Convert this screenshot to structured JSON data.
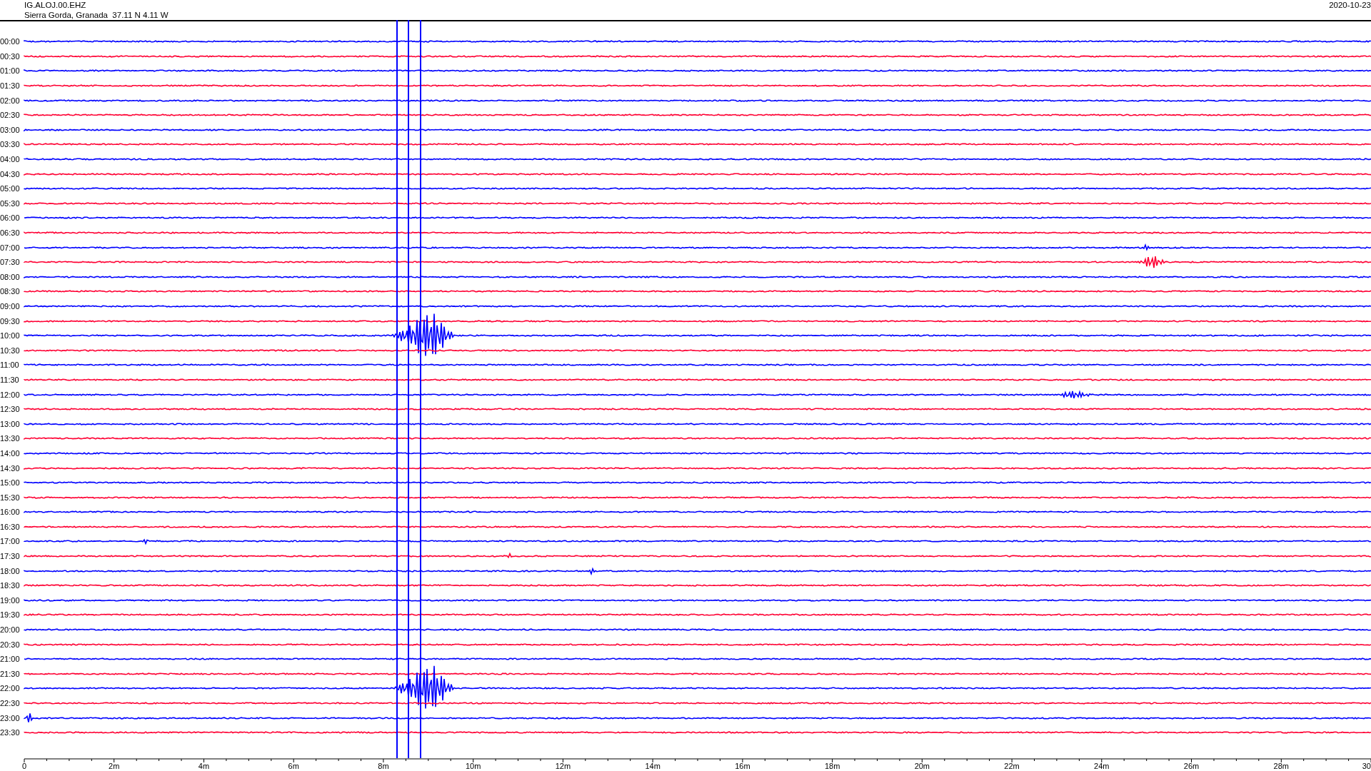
{
  "header": {
    "station": "IG.ALOJ.00.EHZ",
    "location": "Sierra Gorda, Granada  37.11 N 4.11 W",
    "date": "2020-10-23"
  },
  "rows": [
    {
      "label": "00:00",
      "color": "#0000ff"
    },
    {
      "label": "00:30",
      "color": "#ff0033"
    },
    {
      "label": "01:00",
      "color": "#0000ff"
    },
    {
      "label": "01:30",
      "color": "#ff0033"
    },
    {
      "label": "02:00",
      "color": "#0000ff"
    },
    {
      "label": "02:30",
      "color": "#ff0033"
    },
    {
      "label": "03:00",
      "color": "#0000ff"
    },
    {
      "label": "03:30",
      "color": "#ff0033"
    },
    {
      "label": "04:00",
      "color": "#0000ff"
    },
    {
      "label": "04:30",
      "color": "#ff0033"
    },
    {
      "label": "05:00",
      "color": "#0000ff"
    },
    {
      "label": "05:30",
      "color": "#ff0033"
    },
    {
      "label": "06:00",
      "color": "#0000ff"
    },
    {
      "label": "06:30",
      "color": "#ff0033"
    },
    {
      "label": "07:00",
      "color": "#0000ff"
    },
    {
      "label": "07:30",
      "color": "#ff0033"
    },
    {
      "label": "08:00",
      "color": "#0000ff"
    },
    {
      "label": "08:30",
      "color": "#ff0033"
    },
    {
      "label": "09:00",
      "color": "#0000ff"
    },
    {
      "label": "09:30",
      "color": "#ff0033"
    },
    {
      "label": "10:00",
      "color": "#0000ff"
    },
    {
      "label": "10:30",
      "color": "#ff0033"
    },
    {
      "label": "11:00",
      "color": "#0000ff"
    },
    {
      "label": "11:30",
      "color": "#ff0033"
    },
    {
      "label": "12:00",
      "color": "#0000ff"
    },
    {
      "label": "12:30",
      "color": "#ff0033"
    },
    {
      "label": "13:00",
      "color": "#0000ff"
    },
    {
      "label": "13:30",
      "color": "#ff0033"
    },
    {
      "label": "14:00",
      "color": "#0000ff"
    },
    {
      "label": "14:30",
      "color": "#ff0033"
    },
    {
      "label": "15:00",
      "color": "#0000ff"
    },
    {
      "label": "15:30",
      "color": "#ff0033"
    },
    {
      "label": "16:00",
      "color": "#0000ff"
    },
    {
      "label": "16:30",
      "color": "#ff0033"
    },
    {
      "label": "17:00",
      "color": "#0000ff"
    },
    {
      "label": "17:30",
      "color": "#ff0033"
    },
    {
      "label": "18:00",
      "color": "#0000ff"
    },
    {
      "label": "18:30",
      "color": "#ff0033"
    },
    {
      "label": "19:00",
      "color": "#0000ff"
    },
    {
      "label": "19:30",
      "color": "#ff0033"
    },
    {
      "label": "20:00",
      "color": "#0000ff"
    },
    {
      "label": "20:30",
      "color": "#ff0033"
    },
    {
      "label": "21:00",
      "color": "#0000ff"
    },
    {
      "label": "21:30",
      "color": "#ff0033"
    },
    {
      "label": "22:00",
      "color": "#0000ff"
    },
    {
      "label": "22:30",
      "color": "#ff0033"
    },
    {
      "label": "23:00",
      "color": "#0000ff"
    },
    {
      "label": "23:30",
      "color": "#ff0033"
    }
  ],
  "time_axis": {
    "labels": [
      "0",
      "2m",
      "4m",
      "6m",
      "8m",
      "10m",
      "12m",
      "14m",
      "16m",
      "18m",
      "20m",
      "22m",
      "24m",
      "26m",
      "28m",
      "30"
    ]
  }
}
